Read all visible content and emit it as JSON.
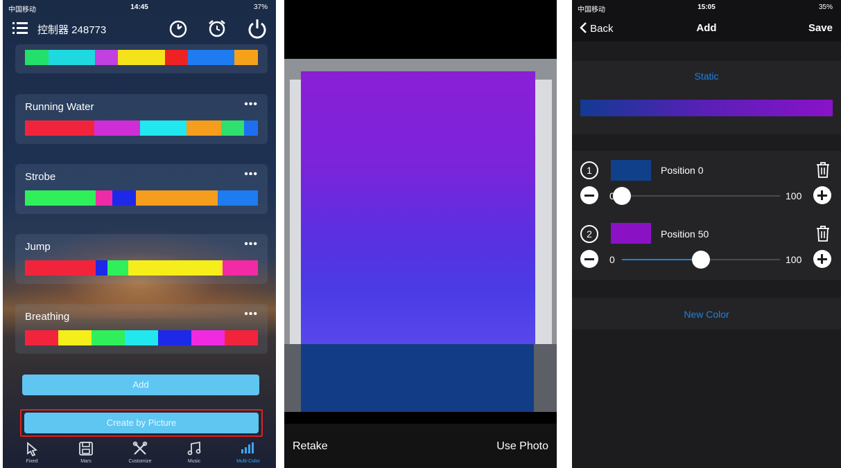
{
  "panel1": {
    "status": {
      "carrier": "中国移动",
      "time": "14:45",
      "battery": "37%"
    },
    "title": "控制器 248773",
    "top_strip": [
      "#22e06a",
      "#1fd9e0",
      "#1fd9e0",
      "#c23fe0",
      "#f4e21a",
      "#f4e21a",
      "#e22",
      "#1e7bf0",
      "#1e7bf0",
      "#f5a21a"
    ],
    "cards": [
      {
        "name": "Running Water",
        "more": "•••",
        "colors": [
          "#f2243c",
          "#f2243c",
          "#cf2ed6",
          "#21e8ee",
          "#f59d1c",
          "#2fe06e",
          "#1e6ff0"
        ],
        "weights": [
          3,
          0,
          2,
          2,
          1.5,
          1,
          0.6
        ]
      },
      {
        "name": "Strobe",
        "more": "•••",
        "colors": [
          "#2ff05a",
          "#ef2aa6",
          "#1e28e8",
          "#f59d1c",
          "#1e7bf0"
        ],
        "weights": [
          3,
          0.7,
          1,
          3.5,
          1.7
        ]
      },
      {
        "name": "Jump",
        "more": "•••",
        "colors": [
          "#f2243c",
          "#1e28e8",
          "#2ff05a",
          "#f6ee1a",
          "#f22aa6"
        ],
        "weights": [
          3,
          0.5,
          0.9,
          4,
          1.5
        ]
      },
      {
        "name": "Breathing",
        "more": "•••",
        "colors": [
          "#f2243c",
          "#f6ee1a",
          "#2ff05a",
          "#21e8ee",
          "#1e28e8",
          "#ef2ae0",
          "#f2243c"
        ],
        "weights": [
          1,
          1,
          1,
          1,
          1,
          1,
          1
        ]
      }
    ],
    "add_label": "Add",
    "create_label": "Create by Picture",
    "tabs": [
      {
        "label": "Fixed",
        "icon": "pin-icon"
      },
      {
        "label": "Mars",
        "icon": "save-icon"
      },
      {
        "label": "Customize",
        "icon": "tools-icon"
      },
      {
        "label": "Music",
        "icon": "music-icon"
      },
      {
        "label": "Multi-Color",
        "icon": "bars-icon"
      }
    ]
  },
  "panel2": {
    "retake": "Retake",
    "use_photo": "Use Photo"
  },
  "panel3": {
    "status": {
      "carrier": "中国移动",
      "time": "15:05",
      "battery": "35%"
    },
    "back": "Back",
    "title": "Add",
    "save": "Save",
    "mode": "Static",
    "colors": [
      {
        "index": "1",
        "color": "#11408a",
        "label": "Position 0",
        "min": "0",
        "max": "100",
        "value": 0
      },
      {
        "index": "2",
        "color": "#8b12c4",
        "label": "Position 50",
        "min": "0",
        "max": "100",
        "value": 50
      }
    ],
    "new_color": "New Color"
  }
}
